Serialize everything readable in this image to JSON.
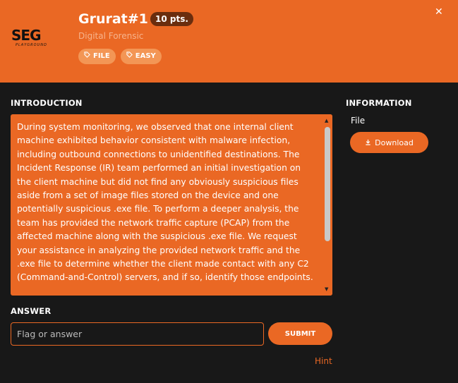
{
  "challenge": {
    "title": "Grurat#1",
    "points": "10 pts.",
    "category": "Digital Forensic",
    "tags": [
      "FILE",
      "EASY"
    ]
  },
  "logo": {
    "mark": "SEG",
    "sub": "PLAYGROUND"
  },
  "sections": {
    "introduction": "INTRODUCTION",
    "information": "INFORMATION",
    "answer": "ANSWER"
  },
  "introduction_text": "During system monitoring, we observed that one internal client machine exhibited behavior consistent with malware infection, including outbound connections to unidentified destinations. The Incident Response (IR) team performed an initial investigation on the client machine but did not find any obviously suspicious files aside from a set of image files stored on the device and one potentially suspicious .exe file. To perform a deeper analysis, the team has provided the network traffic capture (PCAP) from the affected machine along with the suspicious .exe file. We request your assistance in analyzing the provided network traffic and the .exe file to determine whether the client made contact with any C2 (Command-and-Control) servers, and if so, identify those endpoints.",
  "information": {
    "file_label": "File",
    "download_label": "Download"
  },
  "answer": {
    "placeholder": "Flag or answer",
    "submit_label": "SUBMIT",
    "hint_label": "Hint"
  },
  "colors": {
    "accent": "#ea6824",
    "background": "#181818",
    "points_badge": "#6a2d0e",
    "tag_bg": "#f39655"
  }
}
